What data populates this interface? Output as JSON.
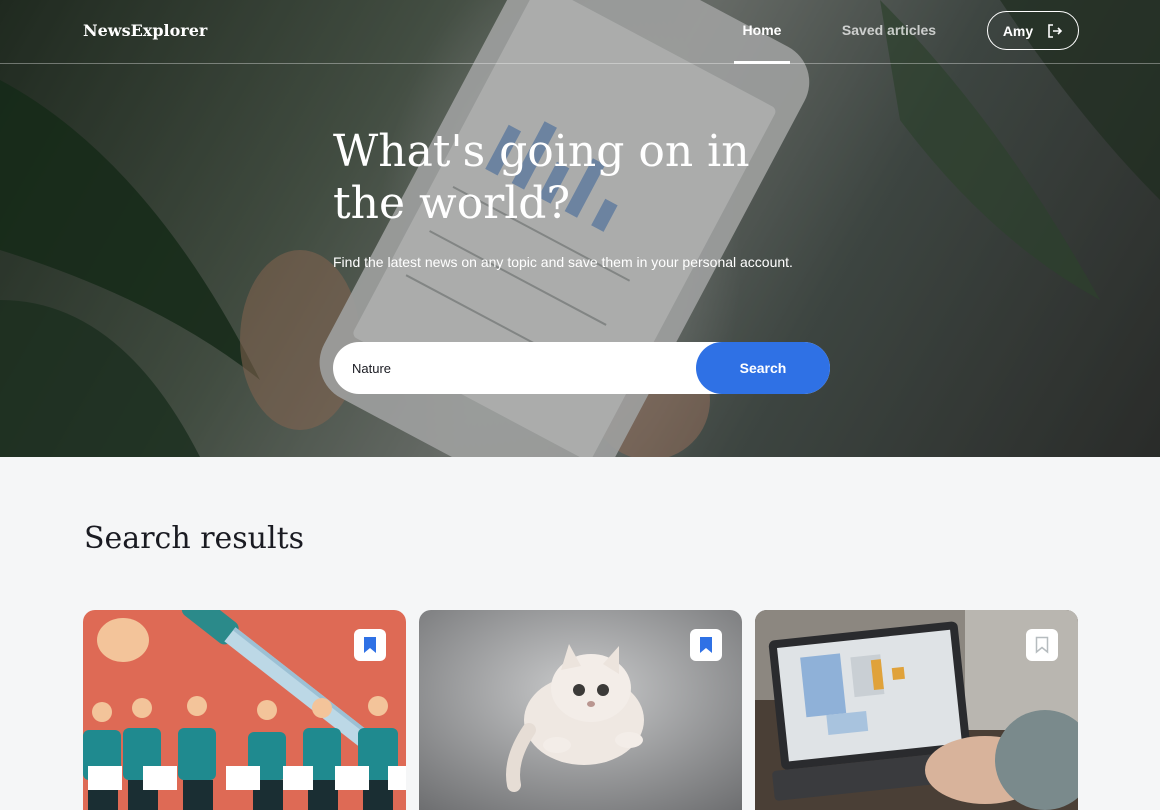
{
  "header": {
    "logo": "NewsExplorer",
    "nav": {
      "home": "Home",
      "saved": "Saved articles"
    },
    "user": {
      "name": "Amy",
      "icon": "logout-icon"
    }
  },
  "hero": {
    "title": "What's going on in the world?",
    "subtitle": "Find the latest news on any topic and save them in your personal account.",
    "search": {
      "value": "Nature",
      "button": "Search"
    }
  },
  "results": {
    "title": "Search results",
    "cards": [
      {
        "image": "illustration-people-knife",
        "bookmarked": true
      },
      {
        "image": "photo-cat-jumping",
        "bookmarked": true
      },
      {
        "image": "photo-laptop-map",
        "bookmarked": false
      }
    ]
  },
  "colors": {
    "accent": "#2f71e5",
    "text_dark": "#1a1b22",
    "bg": "#f5f6f7"
  }
}
